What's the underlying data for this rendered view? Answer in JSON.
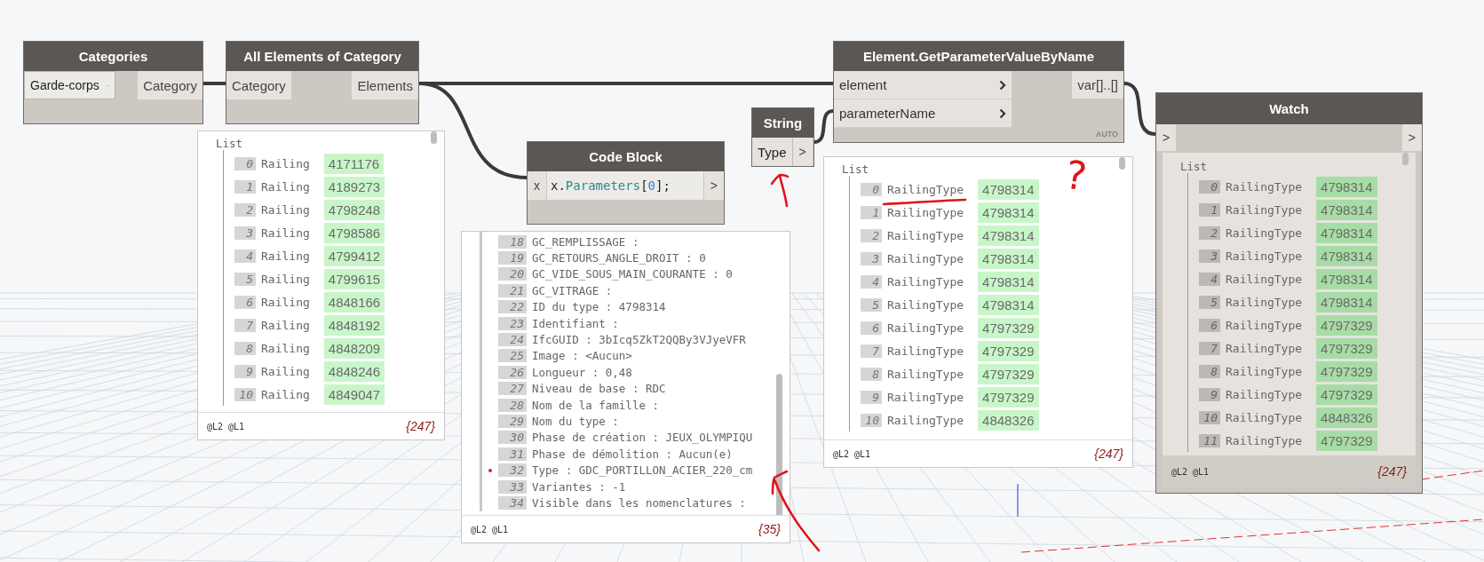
{
  "categories_node": {
    "title": "Categories",
    "value": "Garde-corps",
    "output": "Category"
  },
  "all_elements_node": {
    "title": "All Elements of Category",
    "input": "Category",
    "output": "Elements"
  },
  "elements_preview": {
    "list_label": "List",
    "items": [
      {
        "index": "0",
        "label": "Railing",
        "value": "4171176"
      },
      {
        "index": "1",
        "label": "Railing",
        "value": "4189273"
      },
      {
        "index": "2",
        "label": "Railing",
        "value": "4798248"
      },
      {
        "index": "3",
        "label": "Railing",
        "value": "4798586"
      },
      {
        "index": "4",
        "label": "Railing",
        "value": "4799412"
      },
      {
        "index": "5",
        "label": "Railing",
        "value": "4799615"
      },
      {
        "index": "6",
        "label": "Railing",
        "value": "4848166"
      },
      {
        "index": "7",
        "label": "Railing",
        "value": "4848192"
      },
      {
        "index": "8",
        "label": "Railing",
        "value": "4848209"
      },
      {
        "index": "9",
        "label": "Railing",
        "value": "4848246"
      },
      {
        "index": "10",
        "label": "Railing",
        "value": "4849047"
      }
    ],
    "levels": "@L2 @L1",
    "count": "{247}"
  },
  "code_block_node": {
    "title": "Code Block",
    "input": "x",
    "output": ">",
    "code": [
      {
        "text": "x.",
        "kind": "plain"
      },
      {
        "text": "Parameters",
        "kind": "member"
      },
      {
        "text": "[",
        "kind": "plain"
      },
      {
        "text": "0",
        "kind": "number"
      },
      {
        "text": "];",
        "kind": "plain"
      }
    ]
  },
  "code_preview": {
    "items": [
      {
        "index": "18",
        "text": "GC_REMPLISSAGE :",
        "marked": false
      },
      {
        "index": "19",
        "text": "GC_RETOURS_ANGLE_DROIT : 0",
        "marked": false
      },
      {
        "index": "20",
        "text": "GC_VIDE_SOUS_MAIN_COURANTE : 0",
        "marked": false
      },
      {
        "index": "21",
        "text": "GC_VITRAGE :",
        "marked": false
      },
      {
        "index": "22",
        "text": "ID du type : 4798314",
        "marked": false
      },
      {
        "index": "23",
        "text": "Identifiant :",
        "marked": false
      },
      {
        "index": "24",
        "text": "IfcGUID : 3bIcq5ZkT2QQBy3VJyeVFR",
        "marked": false
      },
      {
        "index": "25",
        "text": "Image : <Aucun>",
        "marked": false
      },
      {
        "index": "26",
        "text": "Longueur : 0,48",
        "marked": false
      },
      {
        "index": "27",
        "text": "Niveau de base : RDC",
        "marked": false
      },
      {
        "index": "28",
        "text": "Nom de la famille :",
        "marked": false
      },
      {
        "index": "29",
        "text": "Nom du type :",
        "marked": false
      },
      {
        "index": "30",
        "text": "Phase de création : JEUX_OLYMPIQU",
        "marked": false
      },
      {
        "index": "31",
        "text": "Phase de démolition : Aucun(e)",
        "marked": false
      },
      {
        "index": "32",
        "text": "Type : GDC_PORTILLON_ACIER_220_cm",
        "marked": true
      },
      {
        "index": "33",
        "text": "Variantes : -1",
        "marked": false
      },
      {
        "index": "34",
        "text": "Visible dans les nomenclatures :",
        "marked": false
      }
    ],
    "levels": "@L2 @L1",
    "count": "{35}"
  },
  "string_node": {
    "title": "String",
    "value": "Type",
    "output": ">"
  },
  "get_parameter_node": {
    "title": "Element.GetParameterValueByName",
    "inputs": [
      "element",
      "parameterName"
    ],
    "output": "var[]..[]",
    "lacing": "AUTO"
  },
  "parameter_preview": {
    "list_label": "List",
    "items": [
      {
        "index": "0",
        "label": "RailingType",
        "value": "4798314"
      },
      {
        "index": "1",
        "label": "RailingType",
        "value": "4798314"
      },
      {
        "index": "2",
        "label": "RailingType",
        "value": "4798314"
      },
      {
        "index": "3",
        "label": "RailingType",
        "value": "4798314"
      },
      {
        "index": "4",
        "label": "RailingType",
        "value": "4798314"
      },
      {
        "index": "5",
        "label": "RailingType",
        "value": "4798314"
      },
      {
        "index": "6",
        "label": "RailingType",
        "value": "4797329"
      },
      {
        "index": "7",
        "label": "RailingType",
        "value": "4797329"
      },
      {
        "index": "8",
        "label": "RailingType",
        "value": "4797329"
      },
      {
        "index": "9",
        "label": "RailingType",
        "value": "4797329"
      },
      {
        "index": "10",
        "label": "RailingType",
        "value": "4848326"
      }
    ],
    "levels": "@L2 @L1",
    "count": "{247}"
  },
  "watch_node": {
    "title": "Watch",
    "input": ">",
    "output": ">",
    "list_label": "List",
    "items": [
      {
        "index": "0",
        "label": "RailingType",
        "value": "4798314"
      },
      {
        "index": "1",
        "label": "RailingType",
        "value": "4798314"
      },
      {
        "index": "2",
        "label": "RailingType",
        "value": "4798314"
      },
      {
        "index": "3",
        "label": "RailingType",
        "value": "4798314"
      },
      {
        "index": "4",
        "label": "RailingType",
        "value": "4798314"
      },
      {
        "index": "5",
        "label": "RailingType",
        "value": "4798314"
      },
      {
        "index": "6",
        "label": "RailingType",
        "value": "4797329"
      },
      {
        "index": "7",
        "label": "RailingType",
        "value": "4797329"
      },
      {
        "index": "8",
        "label": "RailingType",
        "value": "4797329"
      },
      {
        "index": "9",
        "label": "RailingType",
        "value": "4797329"
      },
      {
        "index": "10",
        "label": "RailingType",
        "value": "4848326"
      },
      {
        "index": "11",
        "label": "RailingType",
        "value": "4797329"
      }
    ],
    "levels": "@L2 @L1",
    "count": "{247}"
  },
  "annotation": {
    "question": "?"
  }
}
